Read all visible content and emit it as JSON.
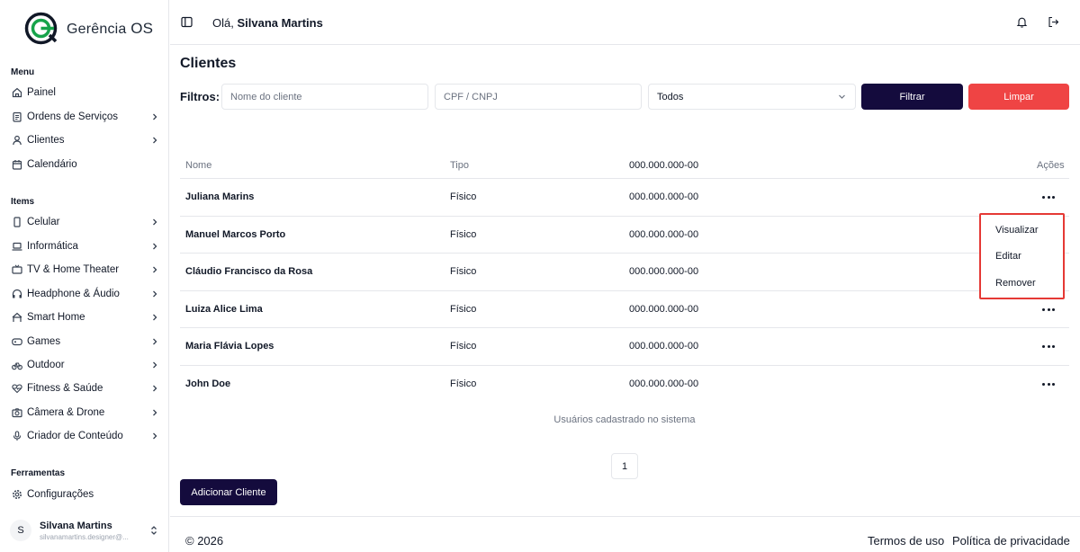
{
  "app": {
    "logo_text_1": "Gerência",
    "logo_text_2": "OS"
  },
  "header": {
    "greeting_prefix": "Olá,",
    "user_name": "Silvana Martins"
  },
  "sidebar": {
    "sections": [
      {
        "title": "Menu",
        "items": [
          {
            "label": "Painel",
            "icon": "home-icon",
            "chevron": false
          },
          {
            "label": "Ordens de Serviços",
            "icon": "clipboard-icon",
            "chevron": true
          },
          {
            "label": "Clientes",
            "icon": "user-icon",
            "chevron": true
          },
          {
            "label": "Calendário",
            "icon": "calendar-icon",
            "chevron": false
          }
        ]
      },
      {
        "title": "Items",
        "items": [
          {
            "label": "Celular",
            "icon": "phone-icon",
            "chevron": true
          },
          {
            "label": "Informática",
            "icon": "laptop-icon",
            "chevron": true
          },
          {
            "label": "TV & Home Theater",
            "icon": "tv-icon",
            "chevron": true
          },
          {
            "label": "Headphone & Áudio",
            "icon": "headphone-icon",
            "chevron": true
          },
          {
            "label": "Smart Home",
            "icon": "smart-home-icon",
            "chevron": true
          },
          {
            "label": "Games",
            "icon": "gamepad-icon",
            "chevron": true
          },
          {
            "label": "Outdoor",
            "icon": "bike-icon",
            "chevron": true
          },
          {
            "label": "Fitness & Saúde",
            "icon": "heart-pulse-icon",
            "chevron": true
          },
          {
            "label": "Câmera & Drone",
            "icon": "camera-icon",
            "chevron": true
          },
          {
            "label": "Criador de Conteúdo",
            "icon": "mic-icon",
            "chevron": true
          }
        ]
      },
      {
        "title": "Ferramentas",
        "items": [
          {
            "label": "Configurações",
            "icon": "gear-icon",
            "chevron": false
          }
        ]
      }
    ],
    "user": {
      "initial": "S",
      "name": "Silvana Martins",
      "email": "silvanamartins.designer@..."
    }
  },
  "page": {
    "title": "Clientes",
    "filters_label": "Filtros:",
    "name_placeholder": "Nome do cliente",
    "doc_placeholder": "CPF / CNPJ",
    "type_select_value": "Todos",
    "filter_button": "Filtrar",
    "clear_button": "Limpar"
  },
  "table": {
    "headers": {
      "name": "Nome",
      "type": "Tipo",
      "doc": "000.000.000-00",
      "actions": "Ações"
    },
    "rows": [
      {
        "name": "Juliana Marins",
        "type": "Físico",
        "doc": "000.000.000-00"
      },
      {
        "name": "Manuel Marcos Porto",
        "type": "Físico",
        "doc": "000.000.000-00"
      },
      {
        "name": "Cláudio Francisco da Rosa",
        "type": "Físico",
        "doc": "000.000.000-00"
      },
      {
        "name": "Luiza Alice Lima",
        "type": "Físico",
        "doc": "000.000.000-00"
      },
      {
        "name": "Maria Flávia Lopes",
        "type": "Físico",
        "doc": "000.000.000-00"
      },
      {
        "name": "John Doe",
        "type": "Físico",
        "doc": "000.000.000-00"
      }
    ],
    "caption": "Usuários cadastrado no sistema"
  },
  "actions_menu": {
    "view": "Visualizar",
    "edit": "Editar",
    "remove": "Remover"
  },
  "pagination": {
    "current": "1"
  },
  "add_button": "Adicionar Cliente",
  "footer": {
    "copyright": "© 2026",
    "terms": "Termos de uso",
    "privacy": "Política de privacidade"
  },
  "colors": {
    "primary": "#140b3d",
    "danger": "#ef4444",
    "logo_green": "#16a34a",
    "highlight_border": "#e53935"
  }
}
